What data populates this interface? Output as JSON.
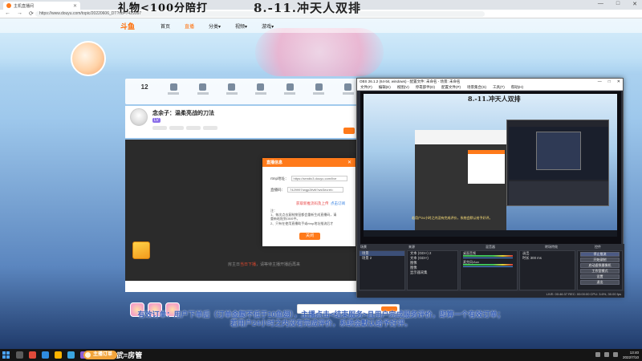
{
  "browser": {
    "tab_title": "主机直播间",
    "url": "https://www.douyu.com/topic/20220606_DT?rid=7429997",
    "window_controls": [
      "—",
      "□",
      "✕"
    ],
    "nav": [
      "←",
      "→",
      "⟳"
    ]
  },
  "stream_overlay": {
    "left_text": "礼物<100分陪打",
    "right_text": "8.-11.冲天人双排"
  },
  "site": {
    "logo": "斗鱼",
    "nav_items": [
      "首页",
      "直播",
      "分类▾",
      "视频▾",
      "游戏▾"
    ]
  },
  "room": {
    "title": "念余子：温柔亮战的刀法",
    "subscribers": "12",
    "level_badge": "LV",
    "hint_prefix": "房主日",
    "hint_highlight": "当日下播",
    "hint_suffix": "，请等待主播开播后再来"
  },
  "dialog": {
    "title": "直播信息",
    "close": "✕",
    "rtmp_label": "rtmp地址：",
    "rtmp_value": "https://sendtc3.douyu.com/live",
    "stream_label": "直播码：",
    "stream_value": "7429997rwgp2lfvltl?wsSecret=",
    "link_left": "获取新推流码及上传",
    "link_right": "点击订阅",
    "notes": [
      "注：",
      "1、每次点击复制按钮都会重新生成直播码，请",
      "   重新粘贴到OBS中。",
      "2、只有在使用直播助手或rtmp地址推流后才"
    ],
    "confirm": "关闭"
  },
  "obs": {
    "title": "OBS 26.1.2 (64-bit, windows) - 配置文件: 未命名 - 场景: 未命名",
    "menu": [
      "文件(F)",
      "编辑(E)",
      "视图(V)",
      "停靠部件(D)",
      "配置文件(P)",
      "场景集合(S)",
      "工具(T)",
      "帮助(H)"
    ],
    "preview_overlay": "8.-11.冲天人双排",
    "dock_labels": [
      "场景",
      "来源",
      "混音器",
      "转场特效",
      "控件"
    ],
    "scenes": [
      "场景",
      "场景 2"
    ],
    "sources": [
      "文本 (GDI+) 2",
      "文本 (GDI+)",
      "图像",
      "图像",
      "显示器采集"
    ],
    "mixer": [
      {
        "name": "桌面音频",
        "value": "0.0 dB"
      },
      {
        "name": "麦克风/Aux",
        "value": "0.0 dB"
      }
    ],
    "transition": {
      "type": "淡出",
      "duration_label": "时长",
      "duration": "300 ms"
    },
    "controls": [
      "停止推流",
      "开始录制",
      "启动虚拟摄像机",
      "工作室模式",
      "设置",
      "退出"
    ],
    "status": "LIVE: 00:46:37   REC: 00:00:00   CPU: 3.6%, 30.00 fps"
  },
  "subtitle": {
    "line1": "有效订单：用户下单后（订单金额不低于10鱼翅），主播点击<结束服务>且用户完成服务评价，即算一个有效订单；",
    "line2": "若用户24小时之内没有完成评价，系统会默认给予好评。"
  },
  "taskbar": {
    "pill_label": "主播订单",
    "name_mark": "武",
    "name_text": "=房管",
    "clock_time": "13:40",
    "clock_date": "2022/7/10"
  },
  "colors": {
    "accent": "#ff7a1a",
    "subtitle": "#3b62b8",
    "obs_bg": "#2b2e38"
  }
}
